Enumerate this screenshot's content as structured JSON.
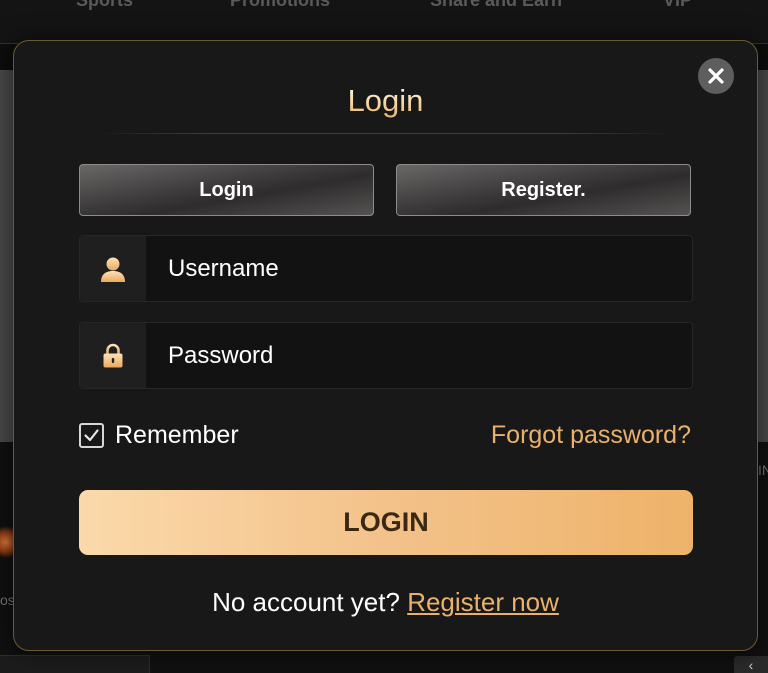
{
  "background": {
    "nav_items": [
      "Sports",
      "Promotions",
      "Share and Earn",
      "VIP"
    ],
    "left_glyph": "os",
    "right_glyph": "IN",
    "scroll_glyph": "‹"
  },
  "modal": {
    "title": "Login",
    "tabs": [
      {
        "label": "Login",
        "active": true
      },
      {
        "label": "Register.",
        "active": false
      }
    ],
    "username": {
      "placeholder": "Username",
      "value": "",
      "icon": "user-icon"
    },
    "password": {
      "placeholder": "Password",
      "value": "",
      "icon": "lock-icon"
    },
    "remember": {
      "label": "Remember",
      "checked": true
    },
    "forgot_label": "Forgot password?",
    "login_button": "LOGIN",
    "footer": {
      "prompt": "No account yet?",
      "link_label": "Register now"
    },
    "close_icon": "close-icon"
  },
  "colors": {
    "accent_gold": "#e9b16d",
    "button_gradient_start": "#fbd9aa",
    "button_gradient_end": "#eeb36a",
    "modal_bg": "#181818",
    "modal_border": "#6b5a34"
  }
}
